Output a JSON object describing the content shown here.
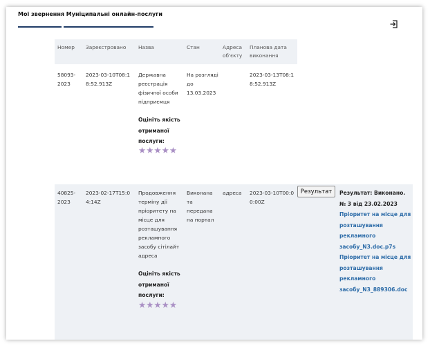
{
  "tabs": {
    "my_requests": "Мої звернення",
    "municipal": "Муніципальні онлайн-послуги"
  },
  "table": {
    "headers": [
      "Номер",
      "Зареєстровано",
      "Назва",
      "Стан",
      "Адреса об'єкту",
      "Планова дата виконання"
    ],
    "rate_label": "Оцініть якість отриманої послуги:",
    "rows": [
      {
        "number": "58093-2023",
        "registered": "2023-03-10T08:18:52.913Z",
        "name": "Державна реєстрація фізичної особи підприємця",
        "status": "На розгляді до 13.03.2023",
        "address": "",
        "planned": "2023-03-13T08:18:52.913Z",
        "stars": "★★★★★"
      },
      {
        "number": "40825-2023",
        "registered": "2023-02-17T15:04:14Z",
        "name": "Продовження терміну дії пріоритету на місце для розташування рекламного засобу сітілайт адреса",
        "status": "Виконана та передана на портал",
        "address": "адреса",
        "planned": "2023-03-10T00:00:00Z",
        "stars": "★★★★★",
        "result_button": "Результат",
        "result_text": "Результат: Виконано. № 3 від 23.02.2023",
        "files": [
          "Пріоритет на місце для розташування рекламного засобу_N3.doc.p7s",
          "Пріоритет на місце для розташування рекламного засобу_N3_889306.doc"
        ]
      }
    ]
  }
}
